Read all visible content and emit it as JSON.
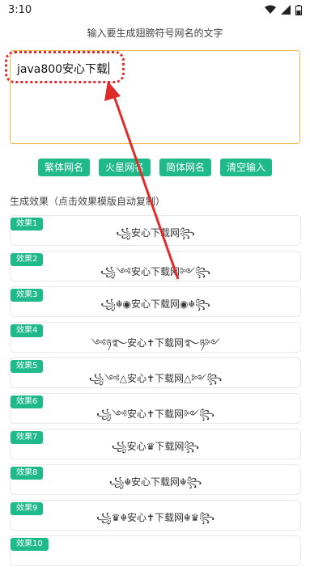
{
  "status": {
    "time": "3:10"
  },
  "prompt": "输入要生成翅膀符号网名的文字",
  "input": {
    "value": "java800安心下载"
  },
  "buttons": [
    "繁体网名",
    "火星网名",
    "简体网名",
    "清空输入"
  ],
  "section_title": "生成效果（点击效果模版自动复制）",
  "results": [
    {
      "tag": "效果1",
      "text": "꧁安心下载网꧂"
    },
    {
      "tag": "效果2",
      "text": "꧁༺安心下载网༻꧂"
    },
    {
      "tag": "效果3",
      "text": "꧁☬◉安心下载网◉☬꧂"
    },
    {
      "tag": "效果4",
      "text": "༺ཉ࿐安心✝下载网࿐ཉ༻"
    },
    {
      "tag": "效果5",
      "text": "꧁༺△安心✝下载网△༻꧂"
    },
    {
      "tag": "效果6",
      "text": "꧁༺安心✝下载网༻꧂"
    },
    {
      "tag": "效果7",
      "text": "꧁安心♛下载网꧂"
    },
    {
      "tag": "效果8",
      "text": "꧁☬安心下载网☬꧂"
    },
    {
      "tag": "效果9",
      "text": "꧁♛☬安心✝下载网☬♛꧂"
    },
    {
      "tag": "效果10",
      "text": ""
    }
  ],
  "colors": {
    "accent": "#1fb98a",
    "highlight": "#e02b2b",
    "input_border": "#f0b74a"
  }
}
